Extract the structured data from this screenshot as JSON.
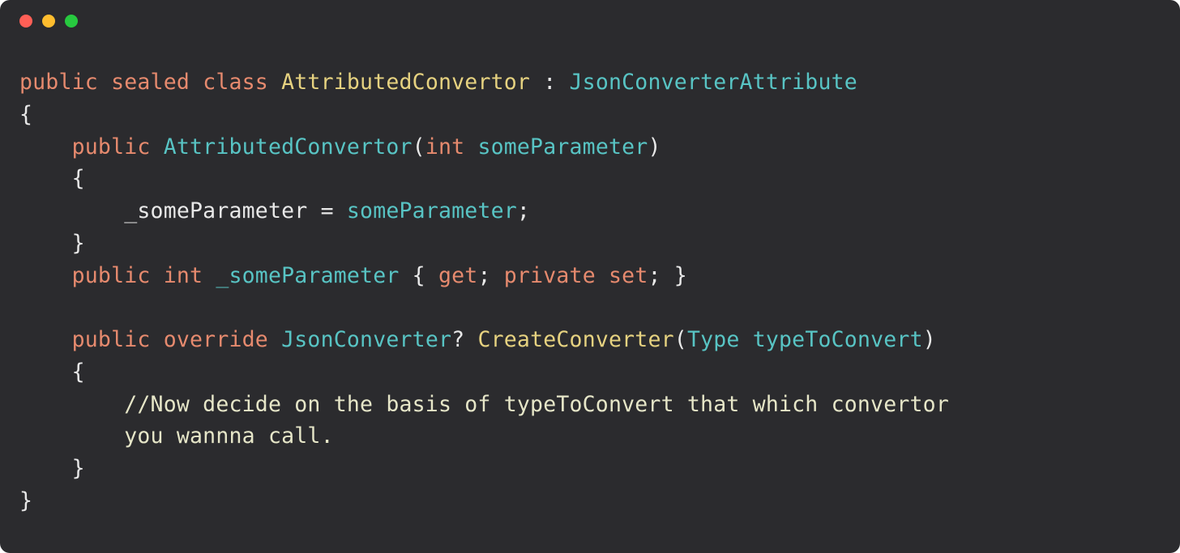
{
  "window": {
    "traffic_lights": [
      "close",
      "minimize",
      "maximize"
    ]
  },
  "code": {
    "line1": {
      "kw1": "public",
      "kw2": "sealed",
      "kw3": "class",
      "classname": "AttributedConvertor",
      "colon": ":",
      "basetype": "JsonConverterAttribute"
    },
    "line2": {
      "brace": "{"
    },
    "line3": {
      "kw1": "public",
      "ctor": "AttributedConvertor",
      "paren_open": "(",
      "kw2": "int",
      "param": "someParameter",
      "paren_close": ")"
    },
    "line4": {
      "brace": "{"
    },
    "line5": {
      "field": "_someParameter",
      "eq": "=",
      "val": "someParameter",
      "semi": ";"
    },
    "line6": {
      "brace": "}"
    },
    "line7": {
      "kw1": "public",
      "kw2": "int",
      "prop": "_someParameter",
      "brace_open": "{",
      "get": "get",
      "semi1": ";",
      "kw3": "private",
      "set": "set",
      "semi2": ";",
      "brace_close": "}"
    },
    "line9": {
      "kw1": "public",
      "kw2": "override",
      "rettype": "JsonConverter",
      "q": "?",
      "method": "CreateConverter",
      "paren_open": "(",
      "paramtype": "Type",
      "param": "typeToConvert",
      "paren_close": ")"
    },
    "line10": {
      "brace": "{"
    },
    "line11": {
      "comment": "//Now decide on the basis of typeToConvert that which convertor"
    },
    "line12": {
      "comment": "you wannna call."
    },
    "line13": {
      "brace": "}"
    },
    "line14": {
      "brace": "}"
    }
  }
}
